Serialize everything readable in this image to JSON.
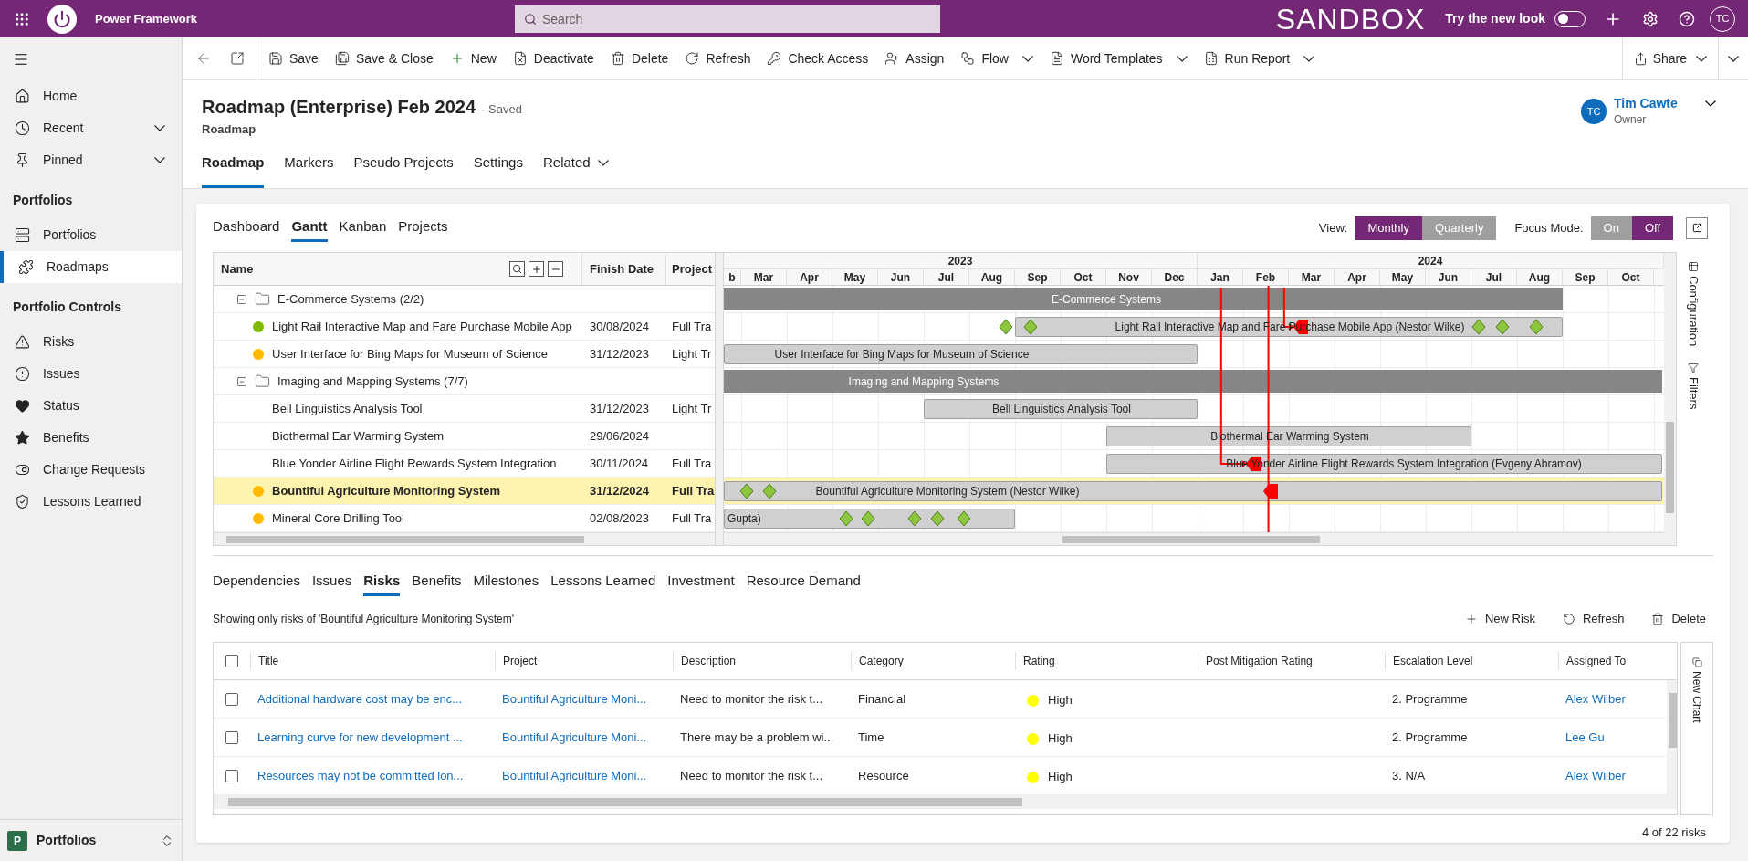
{
  "app": {
    "title": "Power Framework",
    "search_placeholder": "Search",
    "environment": "SANDBOX",
    "new_look": {
      "label": "Try the new look",
      "on": false
    },
    "user_initials": "TC"
  },
  "sidebar": {
    "top": [
      {
        "label": "Home",
        "expandable": false,
        "selected": false
      },
      {
        "label": "Recent",
        "expandable": true,
        "selected": false
      },
      {
        "label": "Pinned",
        "expandable": true,
        "selected": false
      }
    ],
    "sections": [
      {
        "title": "Portfolios",
        "items": [
          {
            "label": "Portfolios",
            "expandable": false,
            "selected": false
          },
          {
            "label": "Roadmaps",
            "expandable": false,
            "selected": true
          }
        ]
      },
      {
        "title": "Portfolio Controls",
        "items": [
          {
            "label": "Risks",
            "expandable": false,
            "selected": false
          },
          {
            "label": "Issues",
            "expandable": false,
            "selected": false
          },
          {
            "label": "Status",
            "expandable": false,
            "selected": false
          },
          {
            "label": "Benefits",
            "expandable": false,
            "selected": false
          },
          {
            "label": "Change Requests",
            "expandable": false,
            "selected": false
          },
          {
            "label": "Lessons Learned",
            "expandable": false,
            "selected": false
          }
        ]
      }
    ],
    "area": {
      "badge": "P",
      "label": "Portfolios"
    }
  },
  "commands": [
    {
      "label": "Save",
      "menu": false
    },
    {
      "label": "Save & Close",
      "menu": false
    },
    {
      "label": "New",
      "menu": false
    },
    {
      "label": "Deactivate",
      "menu": false
    },
    {
      "label": "Delete",
      "menu": false
    },
    {
      "label": "Refresh",
      "menu": false
    },
    {
      "label": "Check Access",
      "menu": false
    },
    {
      "label": "Assign",
      "menu": false
    },
    {
      "label": "Flow",
      "menu": true
    },
    {
      "label": "Word Templates",
      "menu": true
    },
    {
      "label": "Run Report",
      "menu": true
    }
  ],
  "share": {
    "label": "Share",
    "menu": true
  },
  "record": {
    "title": "Roadmap (Enterprise) Feb 2024",
    "status": "- Saved",
    "entity": "Roadmap",
    "owner": {
      "initials": "TC",
      "name": "Tim Cawte",
      "role": "Owner"
    }
  },
  "tabs": [
    {
      "label": "Roadmap",
      "selected": true,
      "menu": false
    },
    {
      "label": "Markers",
      "selected": false,
      "menu": false
    },
    {
      "label": "Pseudo Projects",
      "selected": false,
      "menu": false
    },
    {
      "label": "Settings",
      "selected": false,
      "menu": false
    },
    {
      "label": "Related",
      "selected": false,
      "menu": true
    }
  ],
  "gantt": {
    "tabs": [
      {
        "label": "Dashboard",
        "selected": false
      },
      {
        "label": "Gantt",
        "selected": true
      },
      {
        "label": "Kanban",
        "selected": false
      },
      {
        "label": "Projects",
        "selected": false
      }
    ],
    "view": {
      "label": "View:",
      "options": [
        {
          "label": "Monthly",
          "selected": true
        },
        {
          "label": "Quarterly",
          "selected": false
        }
      ]
    },
    "focus_mode": {
      "label": "Focus Mode:",
      "options": [
        {
          "label": "On",
          "selected": false
        },
        {
          "label": "Off",
          "selected": true
        }
      ]
    },
    "columns": [
      "Name",
      "Finish Date",
      "Project"
    ],
    "years": [
      "2023",
      "2024"
    ],
    "months": [
      "b",
      "Mar",
      "Apr",
      "May",
      "Jun",
      "Jul",
      "Aug",
      "Sep",
      "Oct",
      "Nov",
      "Dec",
      "Jan",
      "Feb",
      "Mar",
      "Apr",
      "May",
      "Jun",
      "Jul",
      "Aug",
      "Sep",
      "Oct"
    ],
    "rows": [
      {
        "kind": "group",
        "name": "E-Commerce Systems (2/2)",
        "expanded": true,
        "bar_label": "E-Commerce Systems"
      },
      {
        "kind": "project",
        "name": "Light Rail Interactive Map and Fare Purchase Mobile App",
        "color": "#7fba00",
        "finish": "30/08/2024",
        "project": "Full Tra",
        "selected": false,
        "bar_label": "Light Rail Interactive Map and Fare Purchase Mobile App (Nestor Wilke)"
      },
      {
        "kind": "project",
        "name": "User Interface for Bing Maps for Museum of Science",
        "color": "#ffb900",
        "finish": "31/12/2023",
        "project": "Light Tr",
        "selected": false,
        "bar_label": "User Interface for Bing Maps for Museum of Science"
      },
      {
        "kind": "group",
        "name": "Imaging and Mapping Systems (7/7)",
        "expanded": true,
        "bar_label": "Imaging and Mapping Systems"
      },
      {
        "kind": "project",
        "name": "Bell Linguistics Analysis Tool",
        "finish": "31/12/2023",
        "project": "Light Tr",
        "selected": false,
        "bar_label": "Bell Linguistics Analysis Tool"
      },
      {
        "kind": "project",
        "name": "Biothermal Ear Warming System",
        "finish": "29/06/2024",
        "selected": false,
        "bar_label": "Biothermal Ear Warming System"
      },
      {
        "kind": "project",
        "name": "Blue Yonder Airline Flight Rewards System Integration",
        "finish": "30/11/2024",
        "project": "Full Tra",
        "selected": false,
        "bar_label": "Blue Yonder Airline Flight Rewards System Integration (Evgeny Abramov)"
      },
      {
        "kind": "project",
        "name": "Bountiful Agriculture Monitoring System",
        "color": "#ffb900",
        "finish": "31/12/2024",
        "project": "Full Tra",
        "selected": true,
        "bar_label": "Bountiful Agriculture Monitoring System (Nestor Wilke)"
      },
      {
        "kind": "project",
        "name": "Mineral Core Drilling Tool",
        "color": "#ffb900",
        "finish": "02/08/2023",
        "project": "Full Tra",
        "selected": false,
        "bar_label": "Gupta)"
      }
    ],
    "side_panel": [
      "Configuration",
      "Filters"
    ]
  },
  "detail": {
    "tabs": [
      {
        "label": "Dependencies",
        "selected": false
      },
      {
        "label": "Issues",
        "selected": false
      },
      {
        "label": "Risks",
        "selected": true
      },
      {
        "label": "Benefits",
        "selected": false
      },
      {
        "label": "Milestones",
        "selected": false
      },
      {
        "label": "Lessons Learned",
        "selected": false
      },
      {
        "label": "Investment",
        "selected": false
      },
      {
        "label": "Resource Demand",
        "selected": false
      }
    ],
    "caption": "Showing only risks of 'Bountiful Agriculture Monitoring System'",
    "actions": [
      "New Risk",
      "Refresh",
      "Delete"
    ],
    "select_all": {
      "checked": false
    },
    "columns": [
      "Title",
      "Project",
      "Description",
      "Category",
      "Rating",
      "Post Mitigation Rating",
      "Escalation Level",
      "Assigned To"
    ],
    "rows": [
      {
        "checked": false,
        "title": "Additional hardware cost may be enc...",
        "project": "Bountiful Agriculture Moni...",
        "description": "Need to monitor the risk t...",
        "category": "Financial",
        "rating": {
          "label": "High",
          "color": "#ffff00"
        },
        "escalation": "2. Programme",
        "assigned": "Alex Wilber"
      },
      {
        "checked": false,
        "title": "Learning curve for new development ...",
        "project": "Bountiful Agriculture Moni...",
        "description": "There may be a problem wi...",
        "category": "Time",
        "rating": {
          "label": "High",
          "color": "#ffff00"
        },
        "escalation": "2. Programme",
        "assigned": "Lee Gu"
      },
      {
        "checked": false,
        "title": "Resources may not be committed lon...",
        "project": "Bountiful Agriculture Moni...",
        "description": "Need to monitor the risk t...",
        "category": "Resource",
        "rating": {
          "label": "High",
          "color": "#ffff00"
        },
        "escalation": "3. N/A",
        "assigned": "Alex Wilber"
      }
    ],
    "side_panel": "New Chart",
    "footer": "4 of 22 risks"
  }
}
